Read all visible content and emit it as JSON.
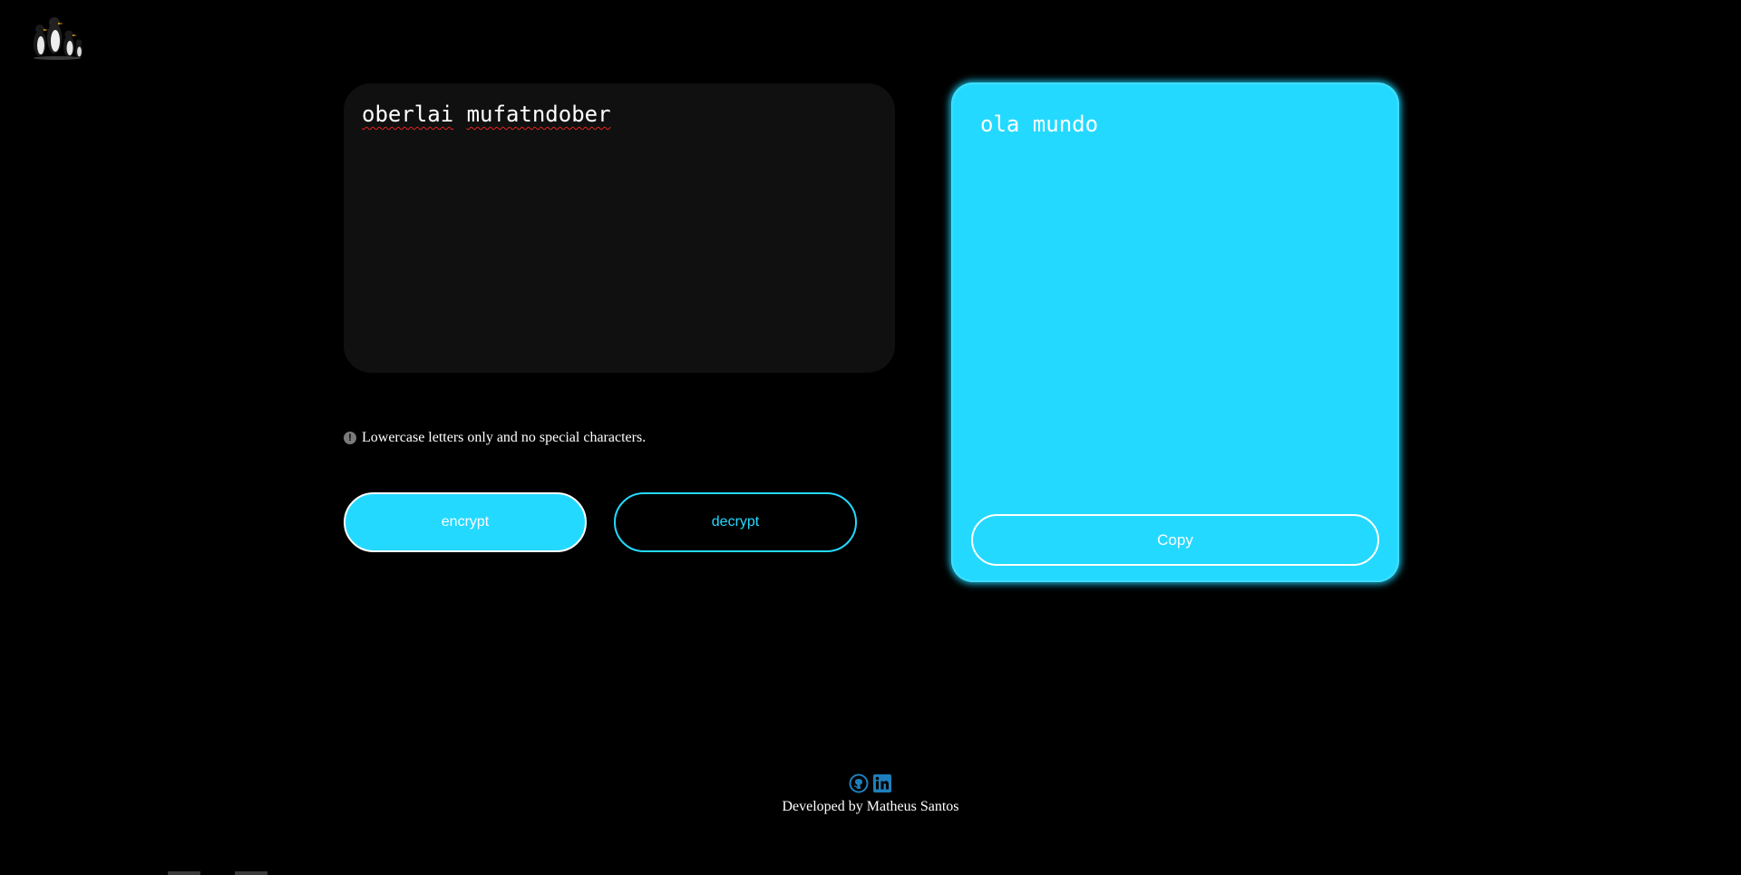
{
  "input": {
    "words": [
      "oberlai",
      "mufatndober"
    ]
  },
  "hint": {
    "icon": "info-icon",
    "text": "Lowercase letters only and no special characters."
  },
  "buttons": {
    "encrypt": "encrypt",
    "decrypt": "decrypt",
    "copy": "Copy"
  },
  "output": {
    "text": "ola mundo"
  },
  "footer": {
    "credit": "Developed by Matheus Santos",
    "icons": [
      "github-icon",
      "linkedin-icon"
    ]
  },
  "colors": {
    "accent": "#24d9ff",
    "background": "#000000",
    "input_bg": "#101010"
  }
}
